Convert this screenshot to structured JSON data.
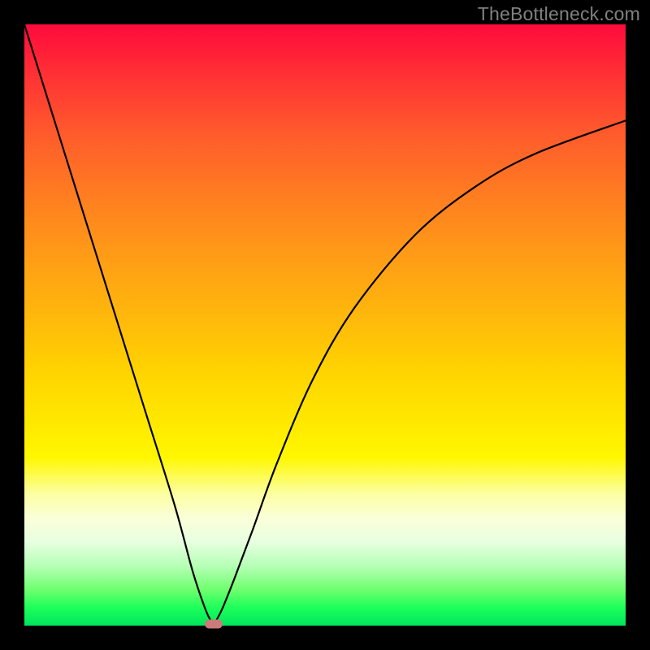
{
  "watermark": "TheBottleneck.com",
  "colors": {
    "background": "#000000",
    "curve": "#000000",
    "marker": "#cc7a7a",
    "watermark_text": "#808080"
  },
  "chart_data": {
    "type": "line",
    "title": "",
    "xlabel": "",
    "ylabel": "",
    "xlim": [
      0,
      100
    ],
    "ylim": [
      0,
      100
    ],
    "series": [
      {
        "name": "bottleneck-curve",
        "x": [
          0,
          5,
          10,
          15,
          20,
          25,
          28,
          30,
          31,
          31.5,
          32,
          33,
          35,
          38,
          42,
          48,
          55,
          65,
          75,
          85,
          100
        ],
        "y": [
          100,
          84,
          68,
          52,
          36,
          20,
          9,
          3,
          0.8,
          0,
          1,
          3,
          8,
          16,
          27,
          41,
          53,
          65,
          73,
          78.5,
          84
        ]
      }
    ],
    "annotations": [
      {
        "name": "minimum-marker",
        "x": 31.5,
        "y": 0
      }
    ],
    "grid": false,
    "legend": false
  }
}
